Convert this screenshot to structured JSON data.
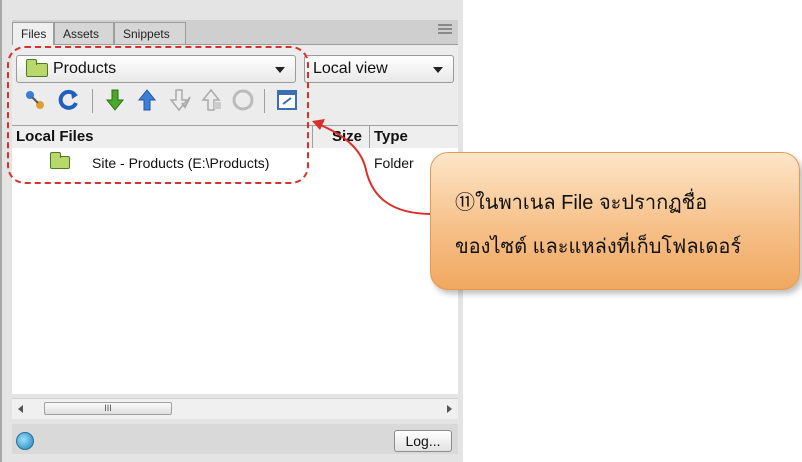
{
  "tabs": [
    "Files",
    "Assets",
    "Snippets"
  ],
  "site_select": {
    "value": "Products"
  },
  "view_select": {
    "value": "Local view"
  },
  "toolbar": {
    "icons": [
      "connect-icon",
      "refresh-icon",
      "get-icon",
      "put-icon",
      "check-out-icon",
      "check-in-icon",
      "synchronize-icon",
      "expand-icon"
    ]
  },
  "list": {
    "headers": [
      "Local Files",
      "Size",
      "Type"
    ],
    "rows": [
      {
        "name": "Site - Products (E:\\Products)",
        "size": "",
        "type": "Folder"
      }
    ]
  },
  "scroll": {
    "thumb_label": "III"
  },
  "status": {
    "log_label": "Log..."
  },
  "callout": {
    "number": "⑪",
    "line1": "ในพาเนล File จะปรากฏชื่อ",
    "line2": "ของไซต์ และแหล่งที่เก็บโฟลเดอร์"
  },
  "colors": {
    "annotation": "#d9302a",
    "callout_fill": "#f6c089"
  }
}
